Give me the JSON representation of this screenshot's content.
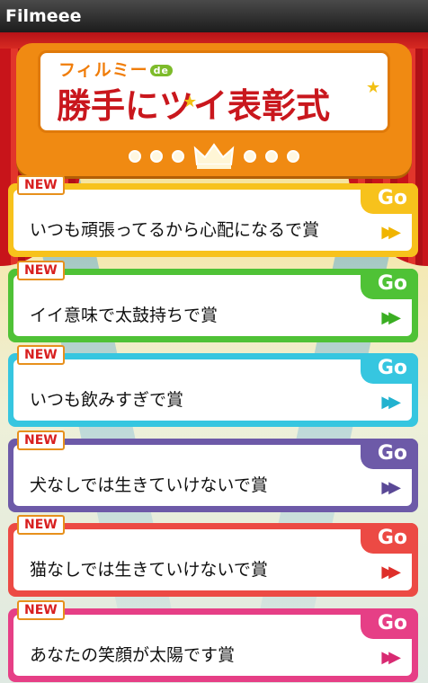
{
  "window": {
    "title": "Filmeee"
  },
  "banner": {
    "brand": "フィルミー",
    "brand_suffix": "de",
    "headline": "勝手にツイ表彰式"
  },
  "awards": [
    {
      "new_badge": "NEW",
      "title": "いつも頑張ってるから心配になるで賞",
      "go_label": "Go",
      "color": "#f7c21c",
      "arrow_color": "#f0b400"
    },
    {
      "new_badge": "NEW",
      "title": "イイ意味で太鼓持ちで賞",
      "go_label": "Go",
      "color": "#4fc236",
      "arrow_color": "#3aae22"
    },
    {
      "new_badge": "NEW",
      "title": "いつも飲みすぎで賞",
      "go_label": "Go",
      "color": "#36c6e0",
      "arrow_color": "#22b2cf"
    },
    {
      "new_badge": "NEW",
      "title": "犬なしでは生きていけないで賞",
      "go_label": "Go",
      "color": "#6d5aa8",
      "arrow_color": "#5a4896"
    },
    {
      "new_badge": "NEW",
      "title": "猫なしでは生きていけないで賞",
      "go_label": "Go",
      "color": "#ec4a44",
      "arrow_color": "#de2f2a"
    },
    {
      "new_badge": "NEW",
      "title": "あなたの笑顔が太陽です賞",
      "go_label": "Go",
      "color": "#e63f86",
      "arrow_color": "#d82a72"
    }
  ],
  "icons": {
    "crown": "crown-icon",
    "forward": "fast-forward-icon"
  }
}
